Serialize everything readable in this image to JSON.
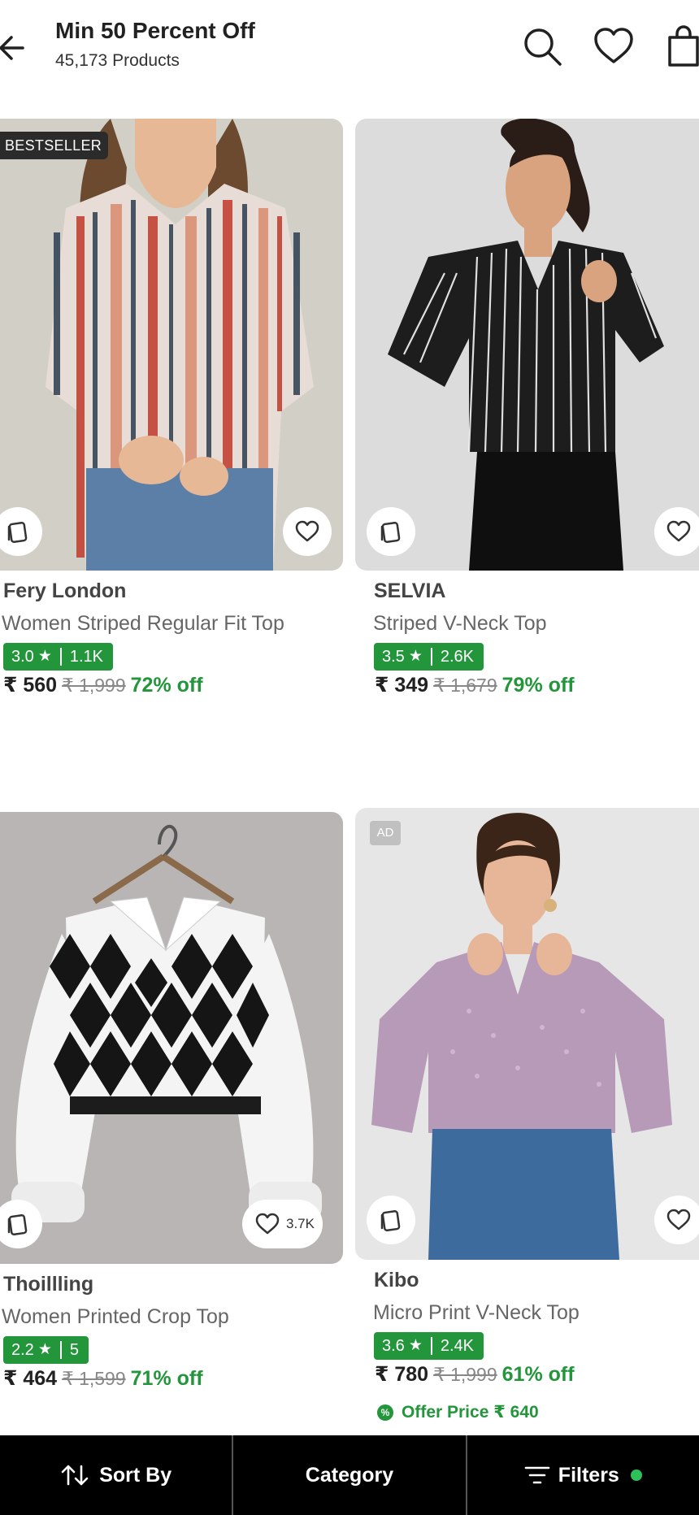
{
  "header": {
    "title": "Min 50 Percent Off",
    "product_count": "45,173 Products"
  },
  "products": [
    {
      "badge": "BESTSELLER",
      "brand": "Fery London",
      "name": "Women Striped Regular Fit Top",
      "rating": "3.0",
      "rating_count": "1.1K",
      "price": "₹ 560",
      "mrp": "₹ 1,999",
      "discount": "72% off"
    },
    {
      "brand": "SELVIA",
      "name": "Striped V-Neck Top",
      "rating": "3.5",
      "rating_count": "2.6K",
      "price": "₹ 349",
      "mrp": "₹ 1,679",
      "discount": "79% off"
    },
    {
      "brand": "Thoillling",
      "name": "Women Printed Crop Top",
      "rating": "2.2",
      "rating_count": "5",
      "price": "₹ 464",
      "mrp": "₹ 1,599",
      "discount": "71% off",
      "wishlist_count": "3.7K"
    },
    {
      "ad_label": "AD",
      "brand": "Kibo",
      "name": "Micro Print V-Neck Top",
      "rating": "3.6",
      "rating_count": "2.4K",
      "price": "₹ 780",
      "mrp": "₹ 1,999",
      "discount": "61% off",
      "offer_text": "Offer Price ₹ 640"
    }
  ],
  "bottom_bar": {
    "sort": "Sort By",
    "category": "Category",
    "filters": "Filters"
  },
  "colors": {
    "accent_green": "#23953b",
    "bottom_bar": "#000000"
  }
}
